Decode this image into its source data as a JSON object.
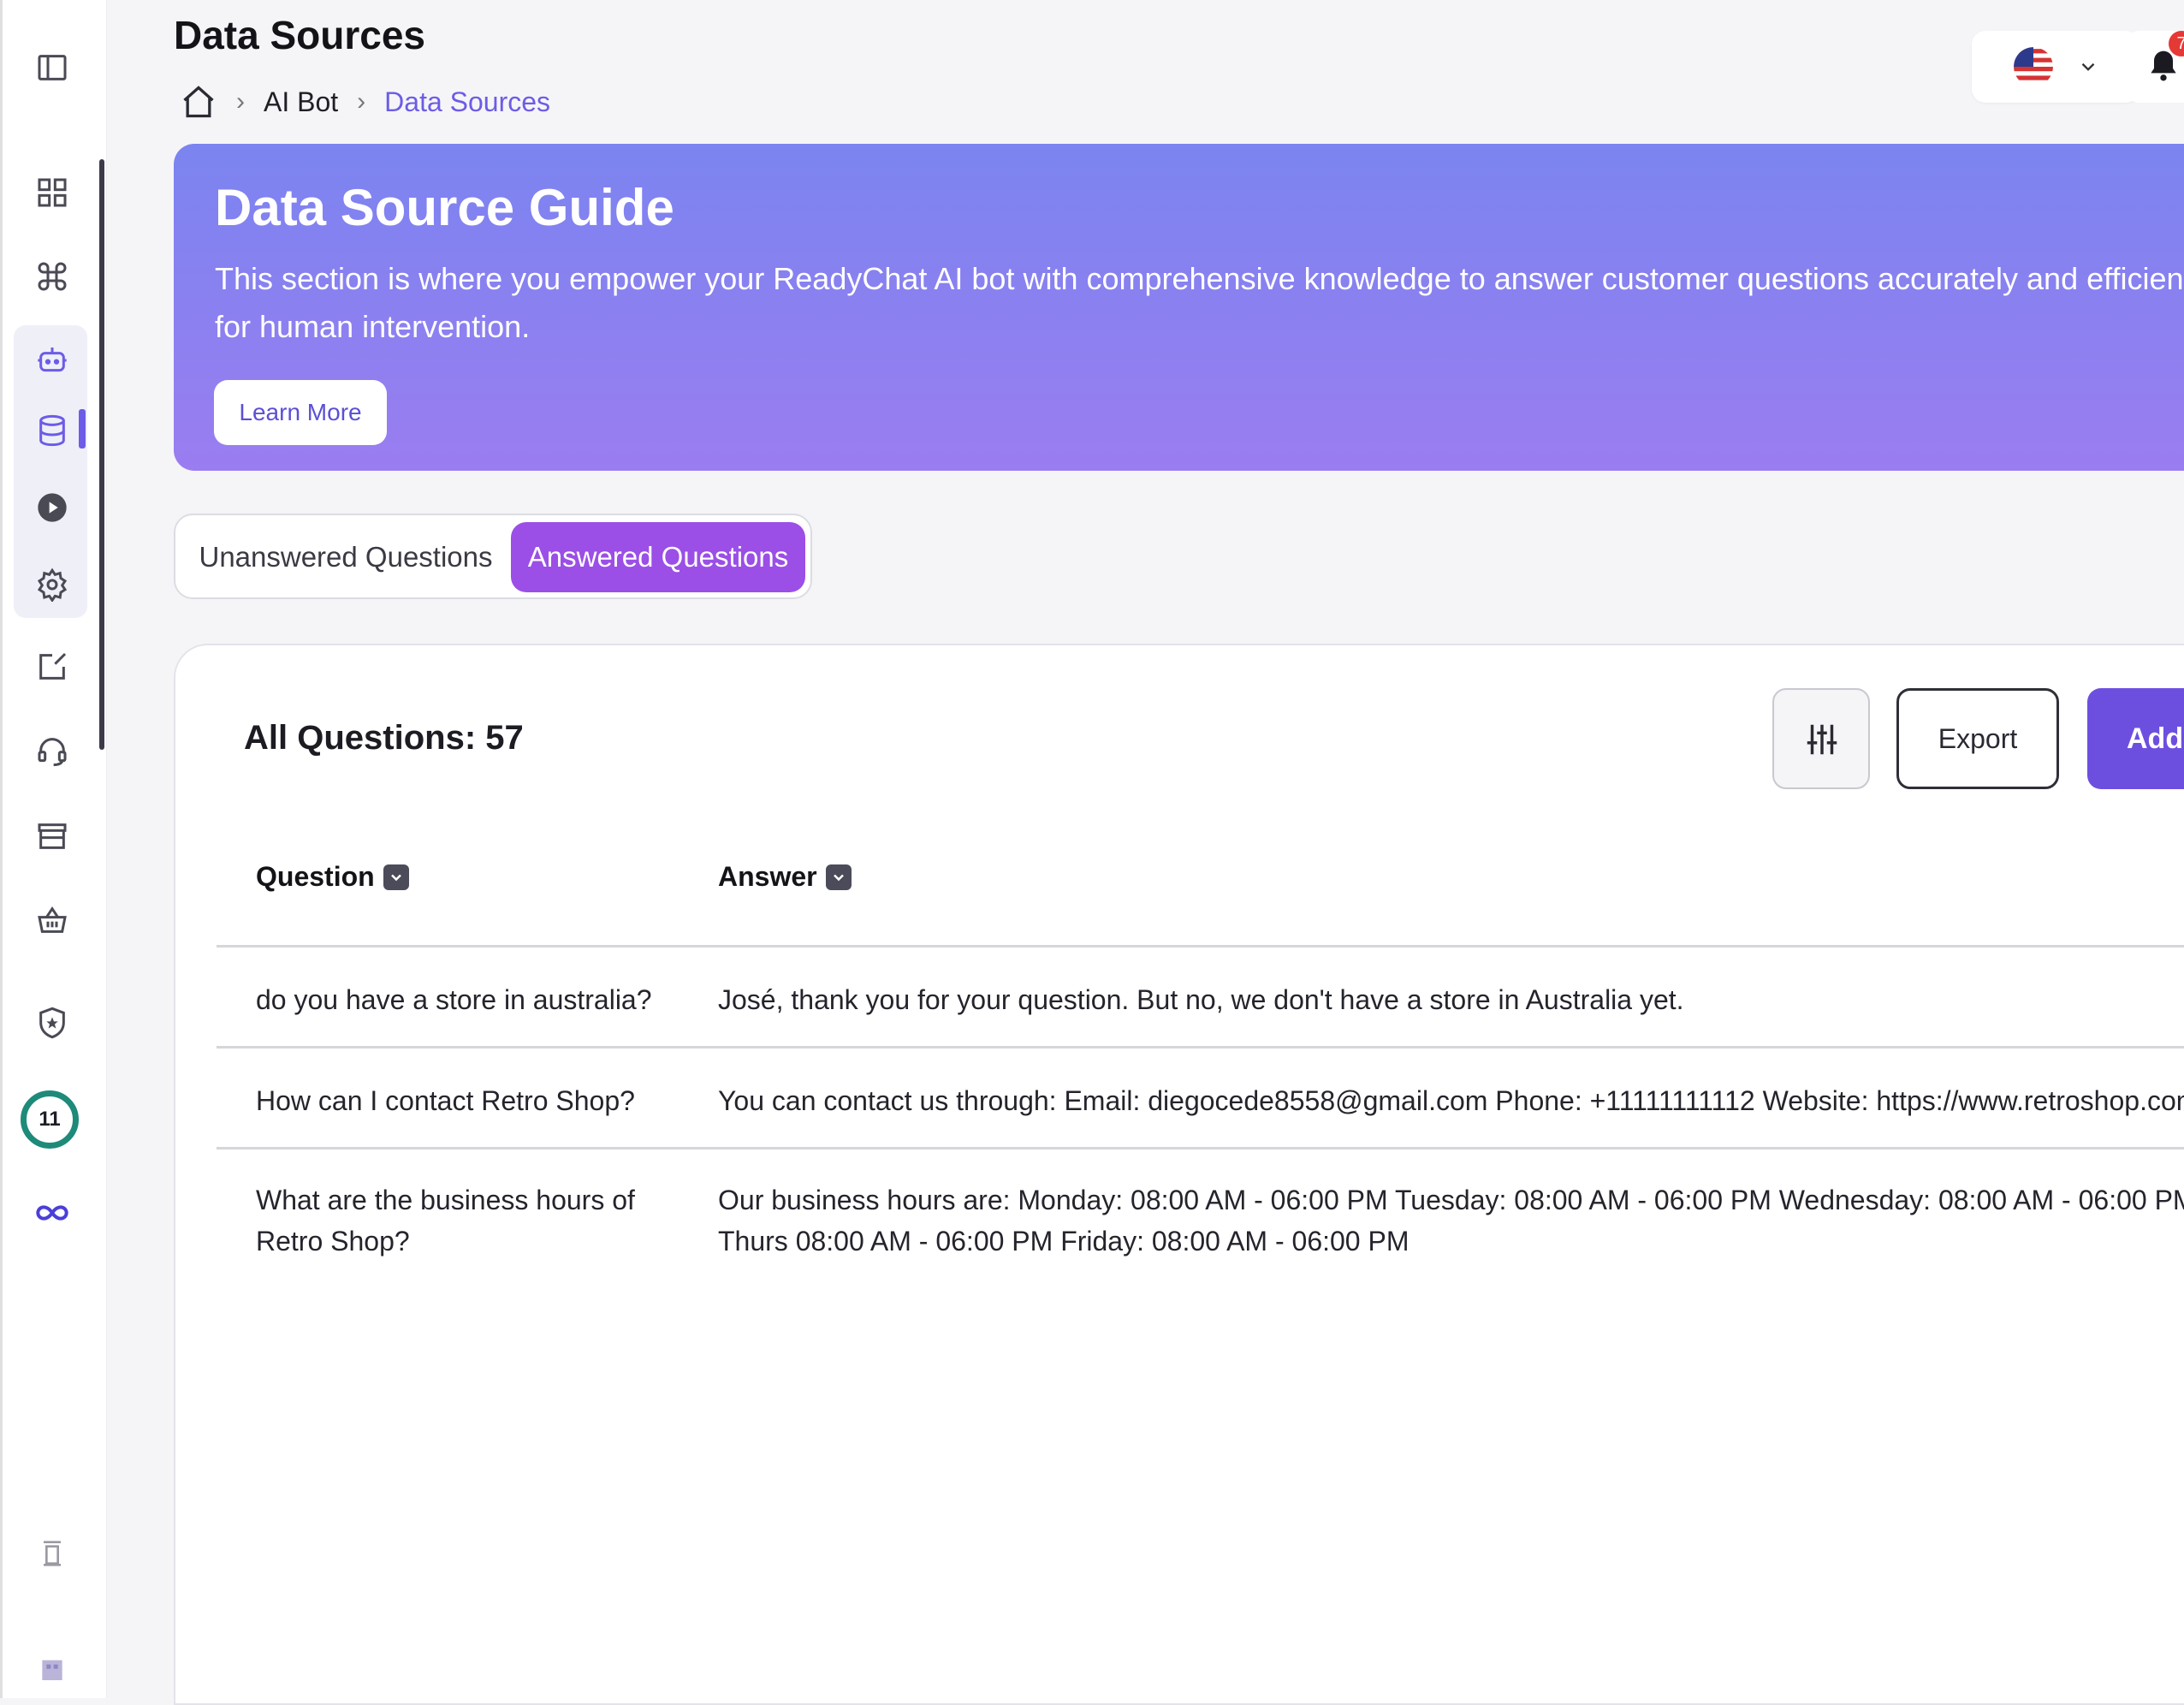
{
  "header": {
    "title": "Data Sources",
    "breadcrumb": [
      "AI Bot",
      "Data Sources"
    ],
    "notification_count": "7"
  },
  "banner": {
    "title": "Data Source Guide",
    "description": "This section is where you empower your ReadyChat AI bot with comprehensive knowledge to answer customer questions accurately and efficiently, re",
    "description_line2": "for human intervention.",
    "button": "Learn More"
  },
  "tabs": [
    {
      "label": "Unanswered Questions",
      "active": false
    },
    {
      "label": "Answered Questions",
      "active": true
    }
  ],
  "card": {
    "count_label": "All Questions: 57",
    "export_label": "Export",
    "add_label": "Add",
    "columns": [
      "Question",
      "Answer"
    ],
    "rows": [
      {
        "question": "do you have a store in australia?",
        "answer": "José, thank you for your question. But no, we don't have a store in Australia yet."
      },
      {
        "question": "How can I contact Retro Shop?",
        "answer": "You can contact us through: Email: diegocede8558@gmail.com Phone: +11111111112 Website: https://www.retroshop.com"
      },
      {
        "question": "What are the business hours of Retro Shop?",
        "answer": "Our business hours are: Monday: 08:00 AM - 06:00 PM Tuesday: 08:00 AM - 06:00 PM Wednesday: 08:00 AM - 06:00 PM Thurs 08:00 AM - 06:00 PM Friday: 08:00 AM - 06:00 PM"
      }
    ]
  },
  "sidebar": {
    "badge_number": "11"
  },
  "colors": {
    "accent": "#6c5ce7",
    "tab_active": "#9b4fe6",
    "banner_start": "#7b84f0",
    "banner_end": "#9a7df0",
    "notification": "#e53935",
    "badge_ring": "#1e8a7a"
  }
}
